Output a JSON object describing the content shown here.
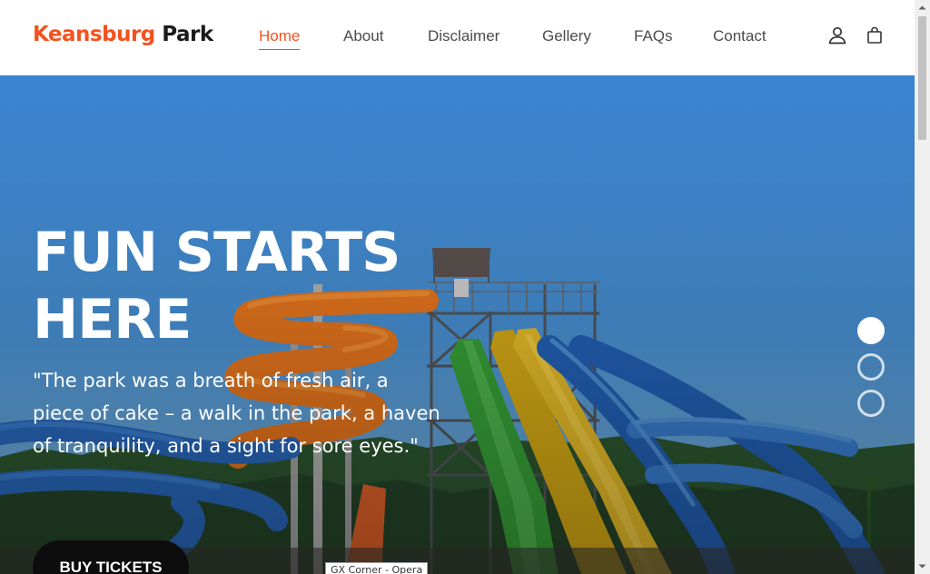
{
  "header": {
    "logo_part1": "Keansburg",
    "logo_part2": "Park",
    "nav": [
      {
        "label": "Home",
        "active": true
      },
      {
        "label": "About",
        "active": false
      },
      {
        "label": "Disclaimer",
        "active": false
      },
      {
        "label": "Gellery",
        "active": false
      },
      {
        "label": "FAQs",
        "active": false
      },
      {
        "label": "Contact",
        "active": false
      }
    ],
    "icons": [
      "user-icon",
      "shopping-bag-icon"
    ]
  },
  "hero": {
    "title_line1": "FUN STARTS",
    "title_line2": "HERE",
    "quote": "\"The park was a breath of fresh air, a piece of cake – a walk in the park, a haven of tranquility, and a sight for sore eyes.\"",
    "cta_label": "BUY TICKETS",
    "slides_total": 3,
    "slide_active": 1
  },
  "tooltip": {
    "text": "GX Corner - Opera"
  },
  "colors": {
    "accent": "#f4511e",
    "text_dark": "#1a1a1a",
    "nav_text": "#4b4b4b",
    "button_bg": "#0d0d0d",
    "sky": "#4593dd"
  }
}
